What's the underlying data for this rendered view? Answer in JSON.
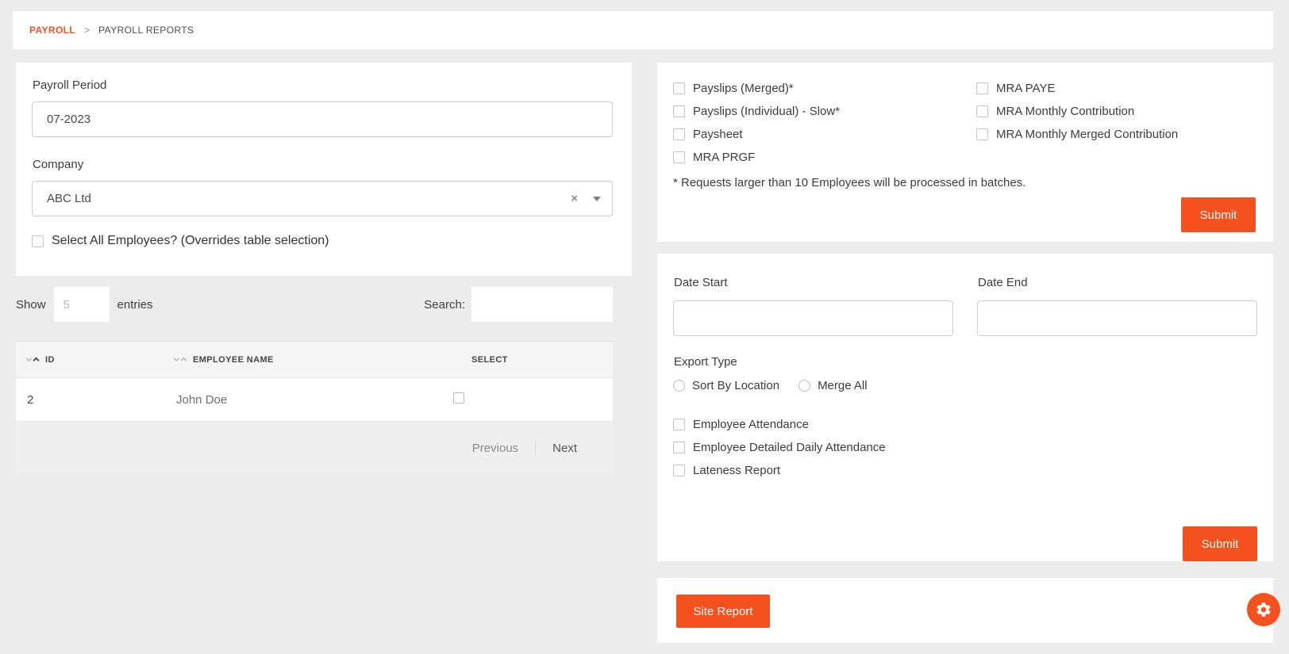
{
  "breadcrumb": {
    "section": "PAYROLL",
    "separator": ">",
    "page": "PAYROLL REPORTS"
  },
  "filter_panel": {
    "payroll_period": {
      "label": "Payroll Period",
      "value": "07-2023"
    },
    "company": {
      "label": "Company",
      "value": "ABC Ltd",
      "clear_icon": "×"
    },
    "select_all": {
      "label": "Select All Employees? (Overrides table selection)",
      "checked": false
    }
  },
  "employee_table": {
    "length_control": {
      "show_label": "Show",
      "value": "5",
      "entries_label": "entries"
    },
    "search": {
      "label": "Search:",
      "value": ""
    },
    "columns": [
      {
        "label": "ID",
        "sortable": true,
        "sorted": "asc"
      },
      {
        "label": "EMPLOYEE NAME",
        "sortable": true,
        "sorted": "none"
      },
      {
        "label": "SELECT",
        "sortable": false
      }
    ],
    "rows": [
      {
        "id": "2",
        "name": "John Doe",
        "selected": false
      }
    ],
    "pagination": {
      "previous_label": "Previous",
      "next_label": "Next"
    }
  },
  "payroll_reports_panel": {
    "options_left": [
      "Payslips (Merged)*",
      "Payslips (Individual) - Slow*",
      "Paysheet",
      "MRA PRGF"
    ],
    "options_right": [
      "MRA PAYE",
      "MRA Monthly Contribution",
      "MRA Monthly Merged Contribution"
    ],
    "note": "* Requests larger than 10 Employees will be processed in batches.",
    "submit_label": "Submit"
  },
  "attendance_panel": {
    "date_start": {
      "label": "Date Start",
      "value": ""
    },
    "date_end": {
      "label": "Date End",
      "value": ""
    },
    "export_type": {
      "label": "Export Type",
      "options": [
        "Sort By Location",
        "Merge All"
      ]
    },
    "options": [
      "Employee Attendance",
      "Employee Detailed Daily Attendance",
      "Lateness Report"
    ],
    "submit_label": "Submit"
  },
  "site_report_panel": {
    "button_label": "Site Report"
  },
  "colors": {
    "accent": "#f4511e",
    "page_background": "#ececec"
  }
}
